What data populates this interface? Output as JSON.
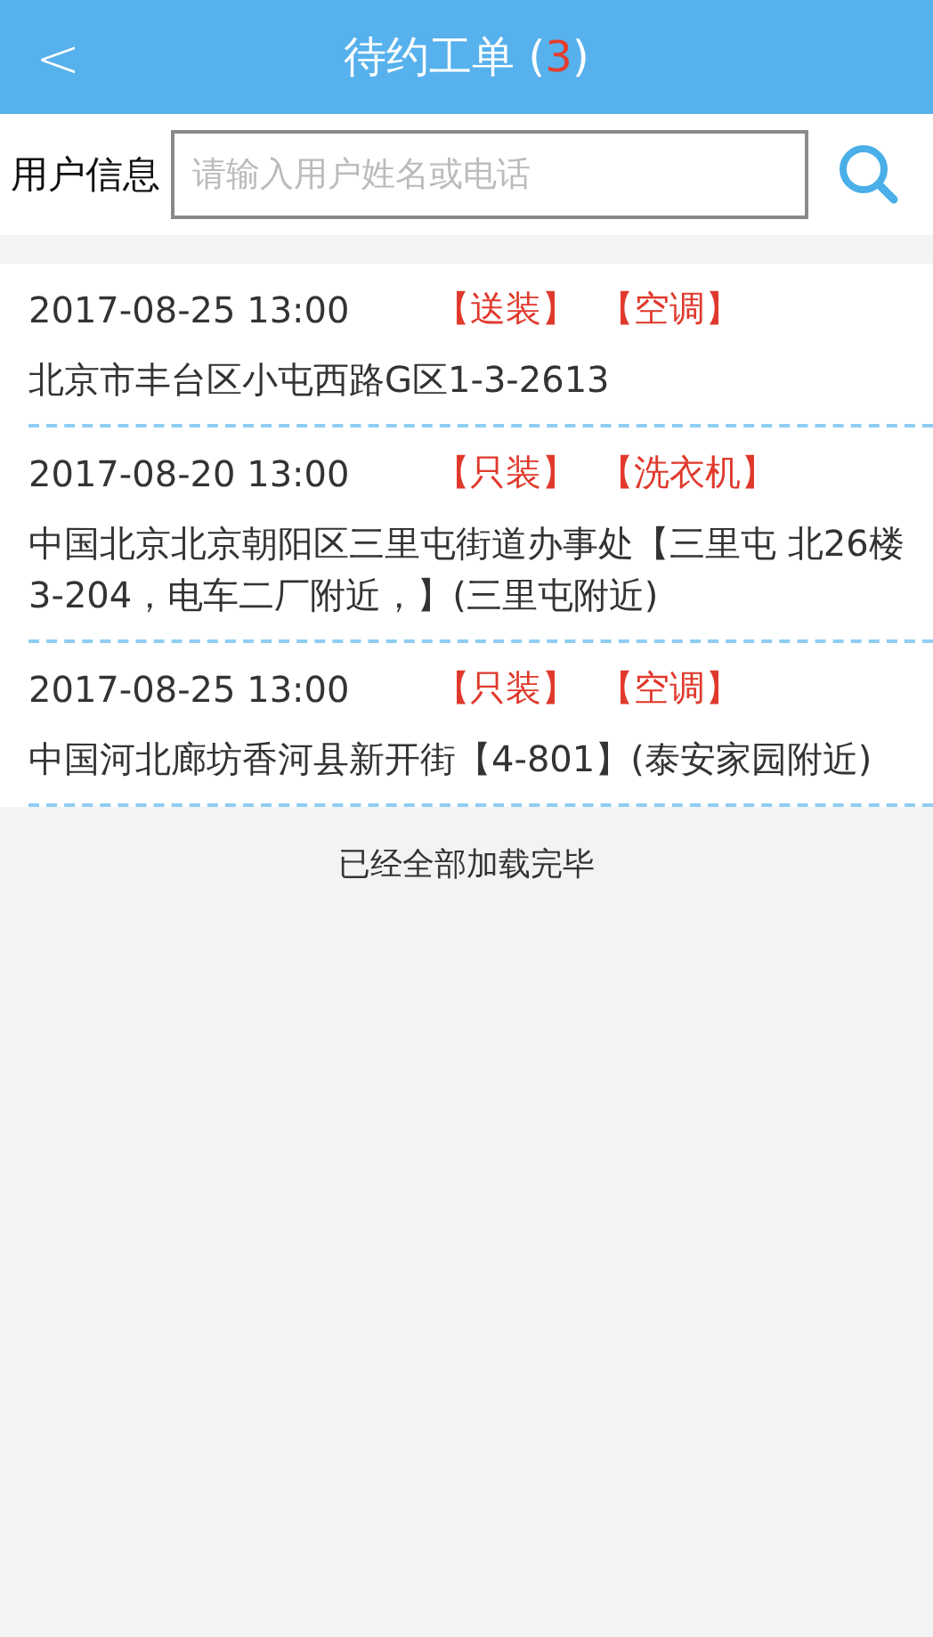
{
  "header": {
    "back": "<",
    "title": "待约工单 (",
    "count": "3",
    "title_end": ")"
  },
  "search": {
    "label": "用户信息",
    "placeholder": "请输入用户姓名或电话"
  },
  "orders": [
    {
      "time": "2017-08-25 13:00",
      "tags": [
        "【送装】",
        "【空调】"
      ],
      "address": "北京市丰台区小屯西路G区1-3-2613"
    },
    {
      "time": "2017-08-20 13:00",
      "tags": [
        "【只装】",
        "【洗衣机】"
      ],
      "address": "中国北京北京朝阳区三里屯街道办事处【三里屯 北26楼3-204，电车二厂附近，】(三里屯附近)"
    },
    {
      "time": "2017-08-25 13:00",
      "tags": [
        "【只装】",
        "【空调】"
      ],
      "address": "中国河北廊坊香河县新开街【4-801】(泰安家园附近)"
    }
  ],
  "footer": "已经全部加载完毕"
}
